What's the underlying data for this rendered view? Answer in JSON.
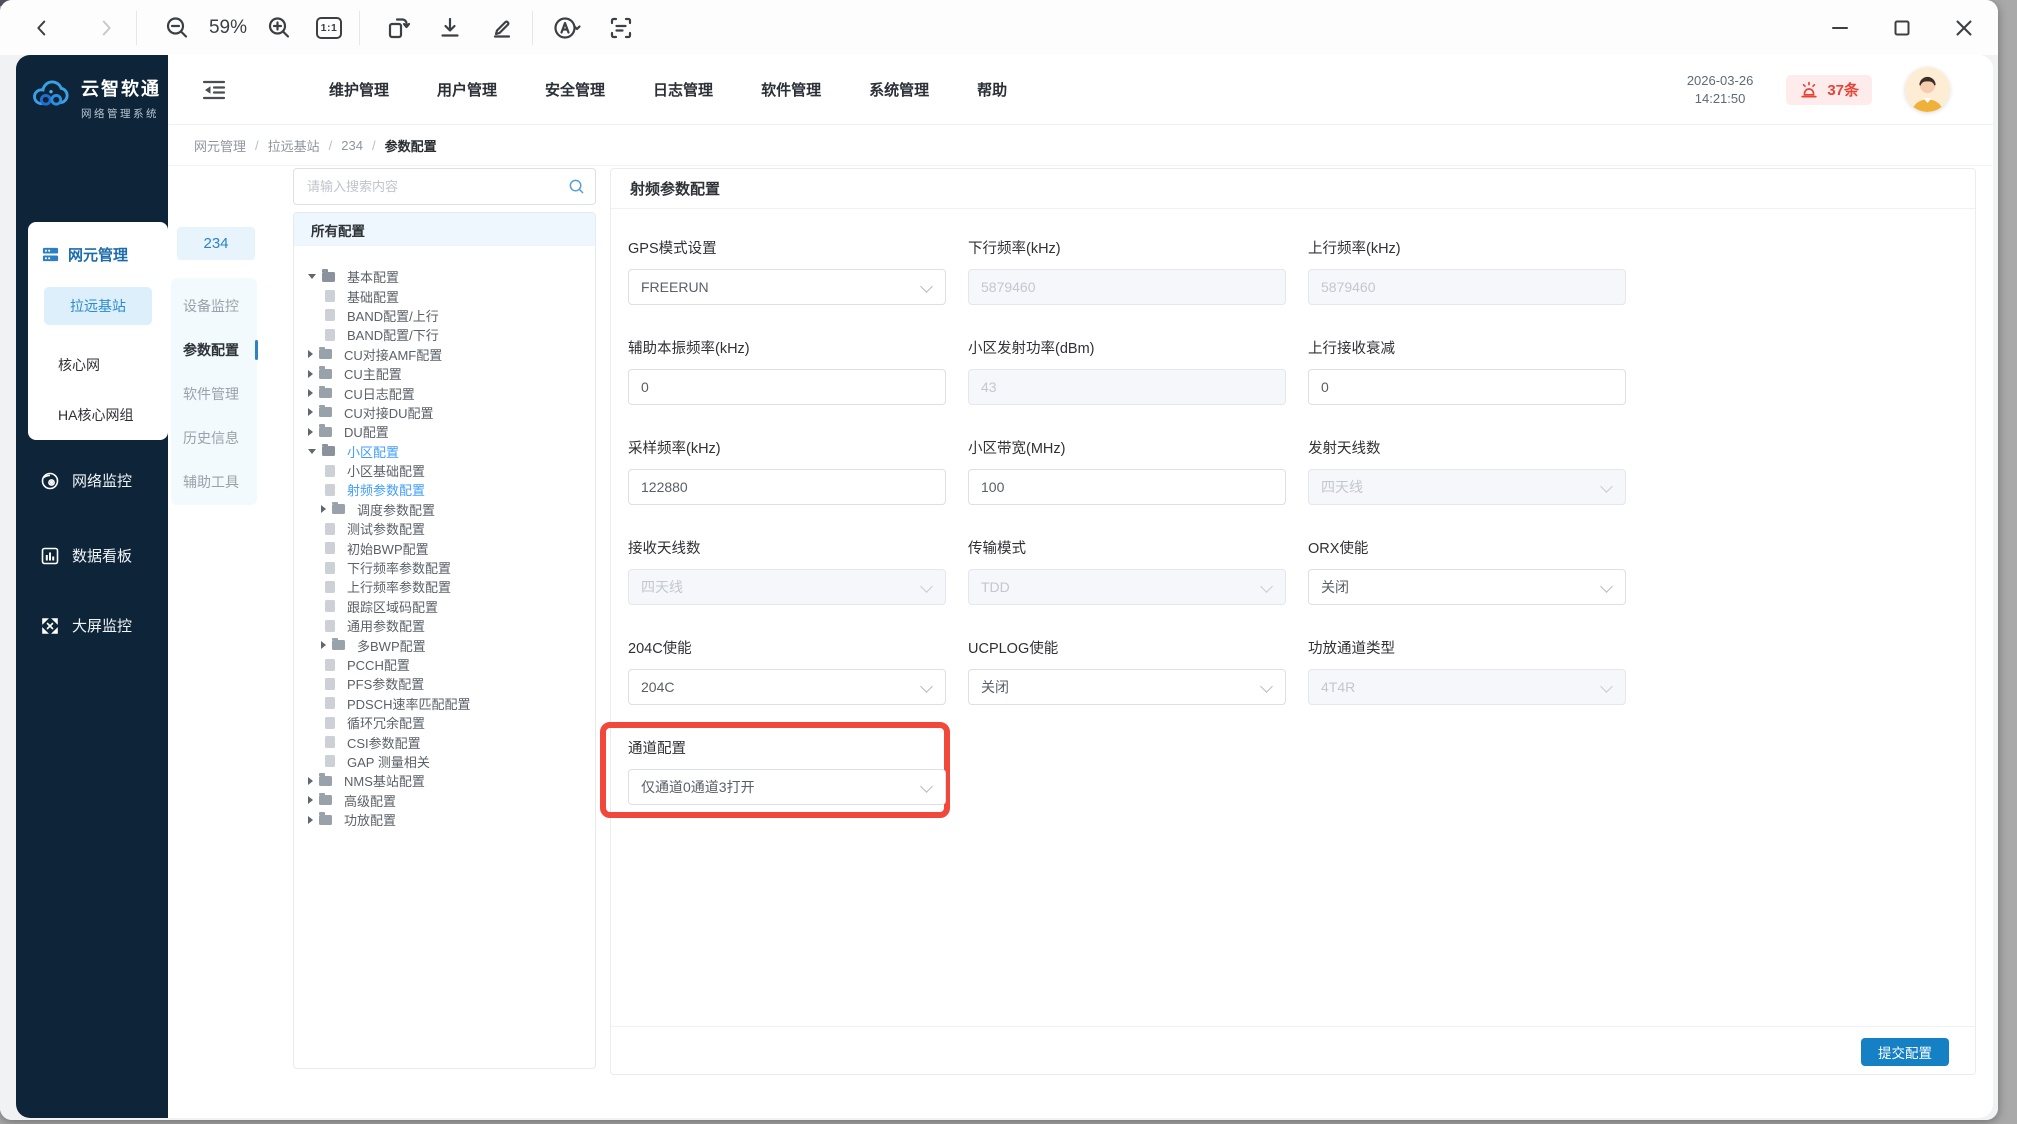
{
  "viewer": {
    "zoom_level": "59%"
  },
  "app": {
    "logo": {
      "title": "云智软通",
      "subtitle": "网络管理系统"
    },
    "sidebar": {
      "group_label": "网元管理",
      "submenu": [
        {
          "label": "拉远基站"
        },
        {
          "label": "核心网"
        },
        {
          "label": "HA核心网组"
        }
      ],
      "items": [
        {
          "label": "网络监控"
        },
        {
          "label": "数据看板"
        },
        {
          "label": "大屏监控"
        }
      ]
    },
    "top_nav": {
      "items": [
        {
          "label": "维护管理"
        },
        {
          "label": "用户管理"
        },
        {
          "label": "安全管理"
        },
        {
          "label": "日志管理"
        },
        {
          "label": "软件管理"
        },
        {
          "label": "系统管理"
        },
        {
          "label": "帮助"
        }
      ]
    },
    "header_right": {
      "date": "2026-03-26",
      "time": "14:21:50",
      "alarm_count": "37条"
    },
    "breadcrumb": {
      "separator": "/",
      "items": [
        "网元管理",
        "拉远基站",
        "234",
        "参数配置"
      ]
    },
    "station": {
      "id": "234",
      "tabs": [
        {
          "label": "设备监控"
        },
        {
          "label": "参数配置"
        },
        {
          "label": "软件管理"
        },
        {
          "label": "历史信息"
        },
        {
          "label": "辅助工具"
        }
      ]
    },
    "tree": {
      "search_placeholder": "请输入搜索内容",
      "header": "所有配置",
      "nodes": [
        {
          "label": "基本配置"
        },
        {
          "label": "基础配置"
        },
        {
          "label": "BAND配置/上行"
        },
        {
          "label": "BAND配置/下行"
        },
        {
          "label": "CU对接AMF配置"
        },
        {
          "label": "CU主配置"
        },
        {
          "label": "CU日志配置"
        },
        {
          "label": "CU对接DU配置"
        },
        {
          "label": "DU配置"
        },
        {
          "label": "小区配置"
        },
        {
          "label": "小区基础配置"
        },
        {
          "label": "射频参数配置"
        },
        {
          "label": "调度参数配置"
        },
        {
          "label": "测试参数配置"
        },
        {
          "label": "初始BWP配置"
        },
        {
          "label": "下行频率参数配置"
        },
        {
          "label": "上行频率参数配置"
        },
        {
          "label": "跟踪区域码配置"
        },
        {
          "label": "通用参数配置"
        },
        {
          "label": "多BWP配置"
        },
        {
          "label": "PCCH配置"
        },
        {
          "label": "PFS参数配置"
        },
        {
          "label": "PDSCH速率匹配配置"
        },
        {
          "label": "循环冗余配置"
        },
        {
          "label": "CSI参数配置"
        },
        {
          "label": "GAP 测量相关"
        },
        {
          "label": "NMS基站配置"
        },
        {
          "label": "高级配置"
        },
        {
          "label": "功放配置"
        }
      ]
    },
    "form": {
      "title": "射频参数配置",
      "fields": [
        {
          "label": "GPS模式设置",
          "value": "FREERUN"
        },
        {
          "label": "下行频率(kHz)",
          "value": "5879460"
        },
        {
          "label": "上行频率(kHz)",
          "value": "5879460"
        },
        {
          "label": "辅助本振频率(kHz)",
          "value": "0"
        },
        {
          "label": "小区发射功率(dBm)",
          "value": "43"
        },
        {
          "label": "上行接收衰减",
          "value": "0"
        },
        {
          "label": "采样频率(kHz)",
          "value": "122880"
        },
        {
          "label": "小区带宽(MHz)",
          "value": "100"
        },
        {
          "label": "发射天线数",
          "value": "四天线"
        },
        {
          "label": "接收天线数",
          "value": "四天线"
        },
        {
          "label": "传输模式",
          "value": "TDD"
        },
        {
          "label": "ORX使能",
          "value": "关闭"
        },
        {
          "label": "204C使能",
          "value": "204C"
        },
        {
          "label": "UCPLOG使能",
          "value": "关闭"
        },
        {
          "label": "功放通道类型",
          "value": "4T4R"
        },
        {
          "label": "通道配置",
          "value": "仅通道0通道3打开"
        }
      ],
      "submit_label": "提交配置"
    }
  },
  "colors": {
    "accent_blue": "#1580c4",
    "sidebar_navy": "#0e2539",
    "highlight_red": "#f2473b",
    "alarm_red": "#e84335",
    "selected_link": "#409eff"
  }
}
